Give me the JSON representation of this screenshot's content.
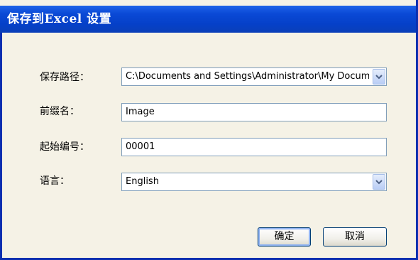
{
  "window": {
    "title": "保存到Excel 设置"
  },
  "form": {
    "save_path_label": "保存路径：",
    "save_path_value": "C:\\Documents and Settings\\Administrator\\My Documents",
    "prefix_label": "前缀名：",
    "prefix_value": "Image",
    "start_number_label": "起始编号：",
    "start_number_value": "00001",
    "language_label": "语言：",
    "language_value": "English"
  },
  "buttons": {
    "ok_label": "确定",
    "cancel_label": "取消"
  },
  "icons": {
    "dropdown": "chevron-down-icon"
  },
  "colors": {
    "titlebar": "#0a49d6",
    "dialog_bg": "#f5f2e6",
    "border": "#0b2fb0"
  }
}
